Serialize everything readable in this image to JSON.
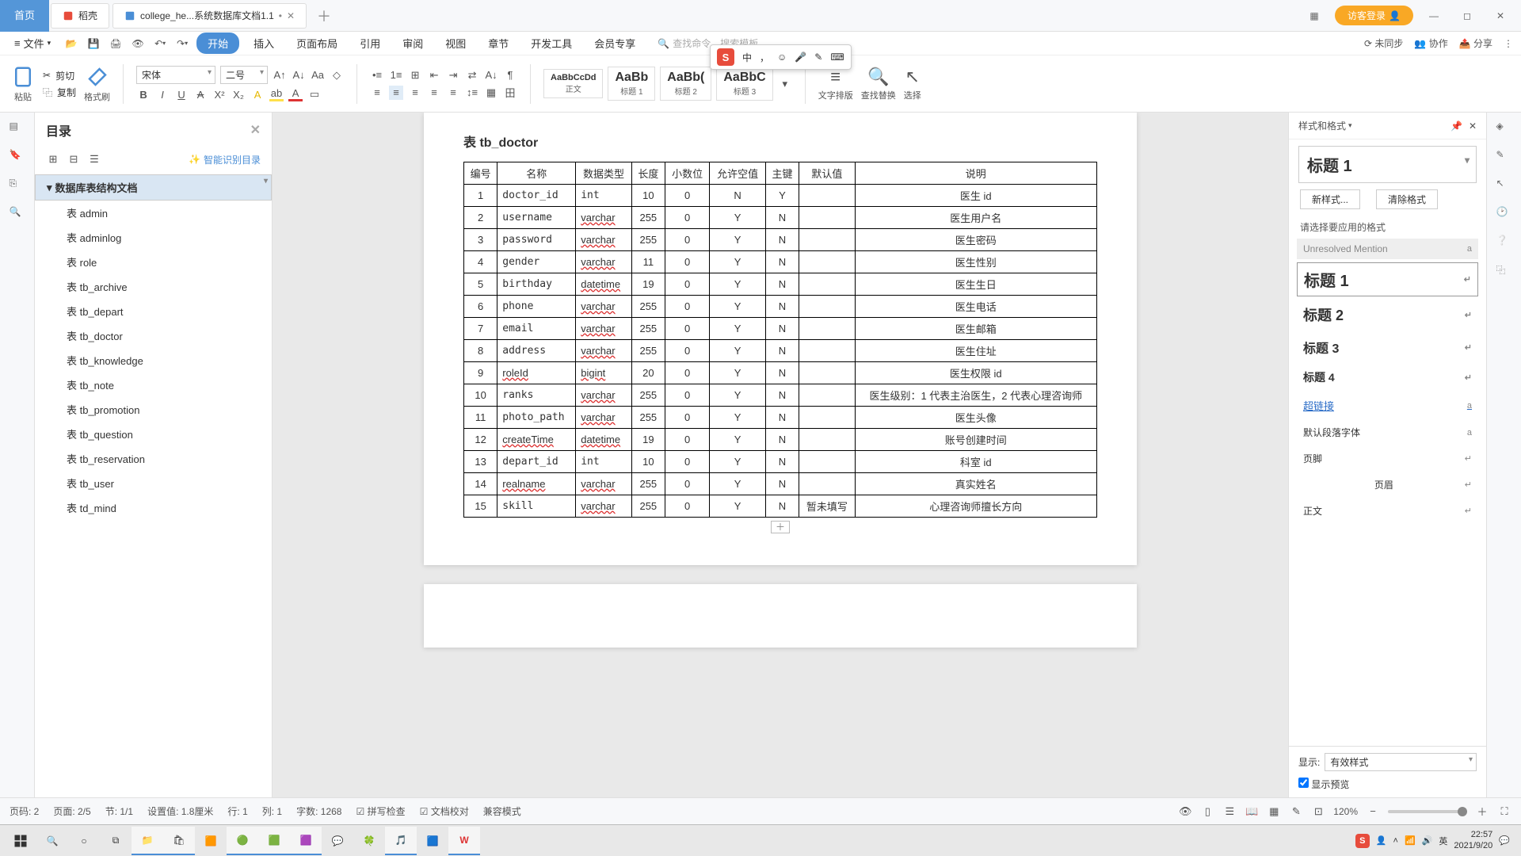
{
  "titlebar": {
    "home": "首页",
    "tab_shell": "稻壳",
    "tab_doc": "college_he...系统数据库文档1.1",
    "login": "访客登录"
  },
  "menubar": {
    "file": "文件",
    "items": [
      "开始",
      "插入",
      "页面布局",
      "引用",
      "审阅",
      "视图",
      "章节",
      "开发工具",
      "会员专享"
    ],
    "search_label": "查找命令、搜索模板",
    "right": {
      "unsync": "未同步",
      "coop": "协作",
      "share": "分享"
    }
  },
  "ribbon": {
    "paste": "粘贴",
    "cut": "剪切",
    "copy": "复制",
    "fmt": "格式刷",
    "font": "宋体",
    "size": "二号",
    "styles": [
      {
        "preview": "AaBbCcDd",
        "name": "正文"
      },
      {
        "preview": "AaBb",
        "name": "标题 1"
      },
      {
        "preview": "AaBb(",
        "name": "标题 2"
      },
      {
        "preview": "AaBbC",
        "name": "标题 3"
      }
    ],
    "text_layout": "文字排版",
    "find": "查找替换",
    "select": "选择"
  },
  "nav": {
    "title": "目录",
    "smart": "智能识别目录",
    "root": "数据库表结构文档",
    "items": [
      "表 admin",
      "表 adminlog",
      "表 role",
      "表 tb_archive",
      "表 tb_depart",
      "表 tb_doctor",
      "表 tb_knowledge",
      "表 tb_note",
      "表 tb_promotion",
      "表 tb_question",
      "表 tb_reservation",
      "表 tb_user",
      "表 td_mind"
    ]
  },
  "doc": {
    "heading": "表 tb_doctor",
    "headers": [
      "编号",
      "名称",
      "数据类型",
      "长度",
      "小数位",
      "允许空值",
      "主键",
      "默认值",
      "说明"
    ],
    "rows": [
      [
        "1",
        "doctor_id",
        "int",
        "10",
        "0",
        "N",
        "Y",
        "",
        "医生 id"
      ],
      [
        "2",
        "username",
        "varchar",
        "255",
        "0",
        "Y",
        "N",
        "",
        "医生用户名"
      ],
      [
        "3",
        "password",
        "varchar",
        "255",
        "0",
        "Y",
        "N",
        "",
        "医生密码"
      ],
      [
        "4",
        "gender",
        "varchar",
        "11",
        "0",
        "Y",
        "N",
        "",
        "医生性别"
      ],
      [
        "5",
        "birthday",
        "datetime",
        "19",
        "0",
        "Y",
        "N",
        "",
        "医生生日"
      ],
      [
        "6",
        "phone",
        "varchar",
        "255",
        "0",
        "Y",
        "N",
        "",
        "医生电话"
      ],
      [
        "7",
        "email",
        "varchar",
        "255",
        "0",
        "Y",
        "N",
        "",
        "医生邮箱"
      ],
      [
        "8",
        "address",
        "varchar",
        "255",
        "0",
        "Y",
        "N",
        "",
        "医生住址"
      ],
      [
        "9",
        "roleId",
        "bigint",
        "20",
        "0",
        "Y",
        "N",
        "",
        "医生权限 id"
      ],
      [
        "10",
        "ranks",
        "varchar",
        "255",
        "0",
        "Y",
        "N",
        "",
        "医生级别：1 代表主治医生，2 代表心理咨询师"
      ],
      [
        "11",
        "photo_path",
        "varchar",
        "255",
        "0",
        "Y",
        "N",
        "",
        "医生头像"
      ],
      [
        "12",
        "createTime",
        "datetime",
        "19",
        "0",
        "Y",
        "N",
        "",
        "账号创建时间"
      ],
      [
        "13",
        "depart_id",
        "int",
        "10",
        "0",
        "Y",
        "N",
        "",
        "科室 id"
      ],
      [
        "14",
        "realname",
        "varchar",
        "255",
        "0",
        "Y",
        "N",
        "",
        "真实姓名"
      ],
      [
        "15",
        "skill",
        "varchar",
        "255",
        "0",
        "Y",
        "N",
        "暂未填写",
        "心理咨询师擅长方向"
      ]
    ]
  },
  "stylepane": {
    "title": "样式和格式",
    "current": "标题 1",
    "new": "新样式...",
    "clear": "清除格式",
    "prompt": "请选择要应用的格式",
    "items": [
      {
        "cls": "grey",
        "name": "Unresolved Mention",
        "mk": "a"
      },
      {
        "cls": "h1 boxed",
        "name": "标题 1",
        "mk": "↵"
      },
      {
        "cls": "h2",
        "name": "标题 2",
        "mk": "↵"
      },
      {
        "cls": "h3",
        "name": "标题 3",
        "mk": "↵"
      },
      {
        "cls": "h4",
        "name": "标题 4",
        "mk": "↵"
      },
      {
        "cls": "link",
        "name": "超链接",
        "mk": "a"
      },
      {
        "cls": "",
        "name": "默认段落字体",
        "mk": "a"
      },
      {
        "cls": "",
        "name": "页脚",
        "mk": "↵"
      },
      {
        "cls": "",
        "name": "页眉",
        "mk": "↵",
        "center": true
      },
      {
        "cls": "",
        "name": "正文",
        "mk": "↵"
      }
    ],
    "show_label": "显示:",
    "show_value": "有效样式",
    "preview": "显示预览"
  },
  "status": {
    "page": "页码: 2",
    "pages": "页面: 2/5",
    "sec": "节: 1/1",
    "pos": "设置值: 1.8厘米",
    "line": "行: 1",
    "col": "列: 1",
    "chars": "字数: 1268",
    "spell": "拼写检查",
    "proof": "文档校对",
    "compat": "兼容模式",
    "zoom": "120%"
  },
  "ime": {
    "lang": "中",
    "punct": "，"
  },
  "taskbar": {
    "time": "22:57",
    "date": "2021/9/20"
  }
}
